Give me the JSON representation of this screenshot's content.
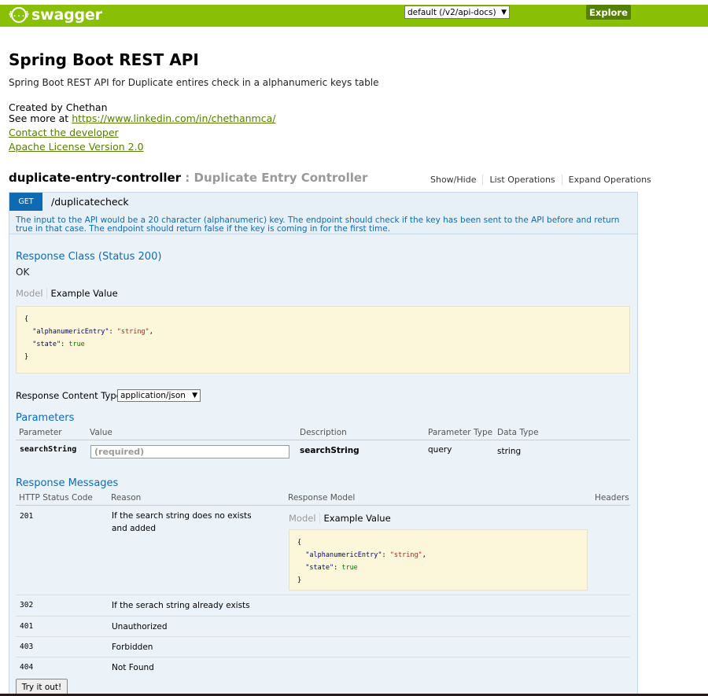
{
  "header": {
    "logo_text": "swagger",
    "logo_icon": "{...}",
    "api_select_value": "default (/v2/api-docs)",
    "explore_label": "Explore"
  },
  "info": {
    "title": "Spring Boot REST API",
    "description": "Spring Boot REST API for Duplicate entires check in a alphanumeric keys table",
    "created_by": "Created by Chethan",
    "see_more_prefix": "See more at ",
    "see_more_link": "https://www.linkedin.com/in/chethanmca/",
    "contact_link": "Contact the developer",
    "license_link": "Apache License Version 2.0"
  },
  "controller": {
    "name": "duplicate-entry-controller",
    "separator": " : ",
    "description": "Duplicate Entry Controller",
    "ops": {
      "show_hide": "Show/Hide",
      "list_operations": "List Operations",
      "expand_operations": "Expand Operations"
    }
  },
  "operation": {
    "method": "GET",
    "path": "/duplicatecheck",
    "notes": "The input to the API would be a 20 character (alphanumeric) key. The endpoint should check if the key has been sent to the API before and return true in that case. The endpoint should return false if the key is coming in for the first time.",
    "response_class_title": "Response Class (Status 200)",
    "response_class_value": "OK",
    "tab_model": "Model",
    "tab_example": "Example Value",
    "example": {
      "open": "{",
      "key1": "\"alphanumericEntry\"",
      "val1": "\"string\"",
      "key2": "\"state\"",
      "val2": "true",
      "close": "}"
    },
    "content_type_label": "Response Content Type",
    "content_type_value": "application/json",
    "parameters_title": "Parameters",
    "param_headers": {
      "parameter": "Parameter",
      "value": "Value",
      "description": "Description",
      "parameter_type": "Parameter Type",
      "data_type": "Data Type"
    },
    "param": {
      "name": "searchString",
      "placeholder": "(required)",
      "description": "searchString",
      "type": "query",
      "data_type": "string"
    },
    "response_messages_title": "Response Messages",
    "resp_headers": {
      "status": "HTTP Status Code",
      "reason": "Reason",
      "model": "Response Model",
      "headers": "Headers"
    },
    "responses": [
      {
        "code": "201",
        "reason": "If the search string does no exists and added"
      },
      {
        "code": "302",
        "reason": "If the serach string already exists"
      },
      {
        "code": "401",
        "reason": "Unauthorized"
      },
      {
        "code": "403",
        "reason": "Forbidden"
      },
      {
        "code": "404",
        "reason": "Not Found"
      }
    ],
    "try_label": "Try it out!"
  }
}
